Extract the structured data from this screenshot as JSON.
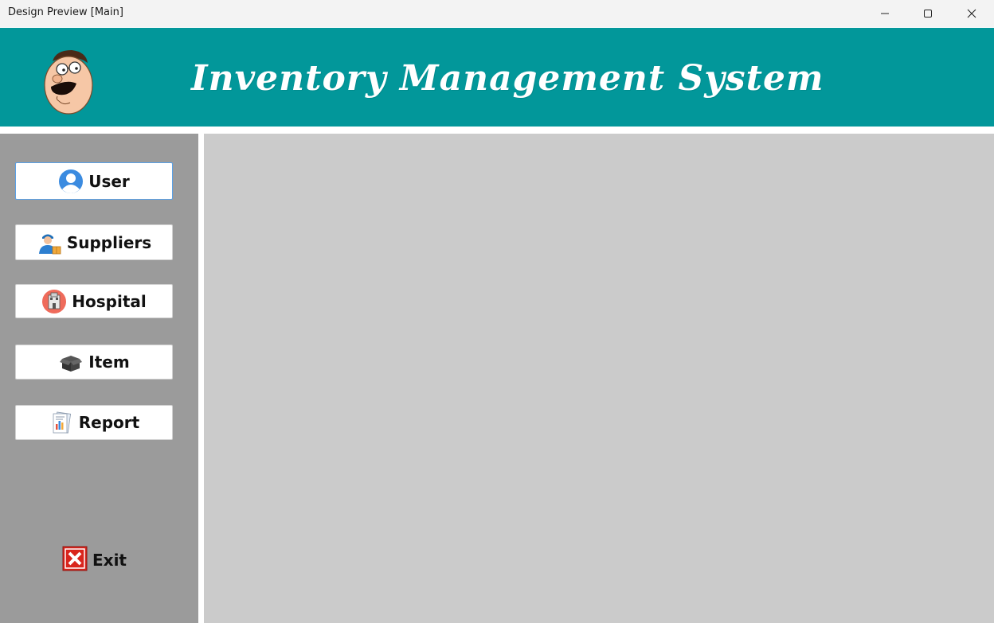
{
  "window": {
    "title": "Design Preview [Main]",
    "controls": [
      "minimize-icon",
      "maximize-icon",
      "close-icon"
    ]
  },
  "header": {
    "title": "Inventory Management System",
    "logo": "cartoon-face-logo",
    "background_color": "#02979a"
  },
  "sidebar": {
    "background_color": "#9b9b9b",
    "items": [
      {
        "label": "User",
        "icon": "user-icon"
      },
      {
        "label": "Suppliers",
        "icon": "supplier-icon"
      },
      {
        "label": "Hospital",
        "icon": "hospital-icon"
      },
      {
        "label": "Item",
        "icon": "box-icon"
      },
      {
        "label": "Report",
        "icon": "report-icon"
      }
    ],
    "exit": {
      "label": "Exit",
      "icon": "exit-icon"
    }
  },
  "content": {
    "background_color": "#cbcbcb"
  }
}
